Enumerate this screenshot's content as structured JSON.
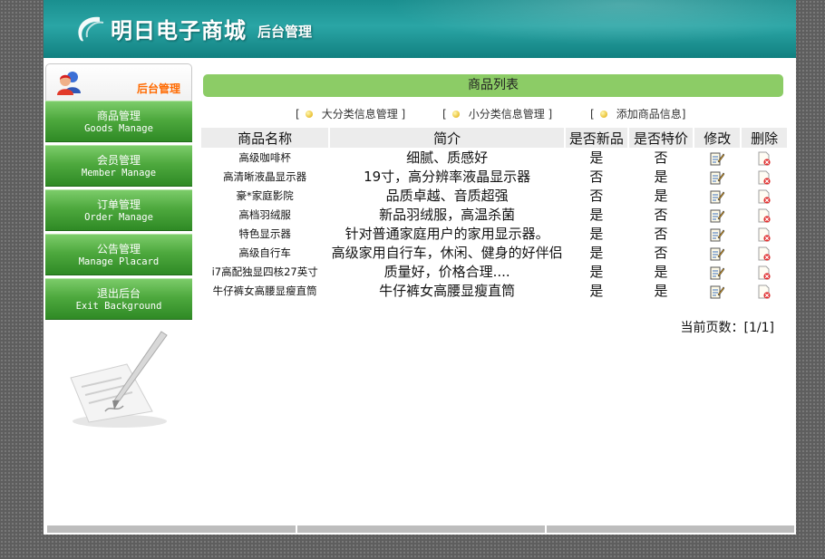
{
  "header": {
    "logo_text": "明日电子商城",
    "logo_sub": "后台管理"
  },
  "sidebar": {
    "title": "后台管理",
    "menu": [
      {
        "cn": "商品管理",
        "en": "Goods Manage"
      },
      {
        "cn": "会员管理",
        "en": "Member Manage"
      },
      {
        "cn": "订单管理",
        "en": "Order Manage"
      },
      {
        "cn": "公告管理",
        "en": "Manage Placard"
      },
      {
        "cn": "退出后台",
        "en": "Exit Background"
      }
    ]
  },
  "main": {
    "title": "商品列表",
    "links": [
      "大分类信息管理",
      "小分类信息管理",
      "添加商品信息"
    ],
    "link_open": "[",
    "link_close": "]",
    "columns": [
      "商品名称",
      "简介",
      "是否新品",
      "是否特价",
      "修改",
      "删除"
    ],
    "rows": [
      {
        "name": "高级咖啡杯",
        "desc": "细腻、质感好",
        "is_new": "是",
        "is_special": "否"
      },
      {
        "name": "高清晰液晶显示器",
        "desc": "19寸，高分辨率液晶显示器",
        "is_new": "否",
        "is_special": "是"
      },
      {
        "name": "豪*家庭影院",
        "desc": "品质卓越、音质超强",
        "is_new": "否",
        "is_special": "是"
      },
      {
        "name": "高档羽绒服",
        "desc": "新品羽绒服，高温杀菌",
        "is_new": "是",
        "is_special": "否"
      },
      {
        "name": "特色显示器",
        "desc": "针对普通家庭用户的家用显示器。",
        "is_new": "是",
        "is_special": "否"
      },
      {
        "name": "高级自行车",
        "desc": "高级家用自行车，休闲、健身的好伴侣",
        "is_new": "是",
        "is_special": "否"
      },
      {
        "name": "i7高配独显四核27英寸",
        "desc": "质量好，价格合理....",
        "is_new": "是",
        "is_special": "是"
      },
      {
        "name": "牛仔裤女高腰显瘦直筒",
        "desc": "牛仔裤女高腰显瘦直筒",
        "is_new": "是",
        "is_special": "是"
      }
    ],
    "pager": "当前页数：[1/1]"
  },
  "icons": {
    "edit": "edit-icon",
    "delete": "delete-icon",
    "link_bullet": "bullet-icon",
    "avatar": "users-icon",
    "quill": "quill-paper-icon"
  },
  "colors": {
    "banner": "#1a8f8f",
    "menu_green": "#4ea93e",
    "title_bar": "#8ccc66",
    "sidebar_title": "#ff6a00"
  }
}
